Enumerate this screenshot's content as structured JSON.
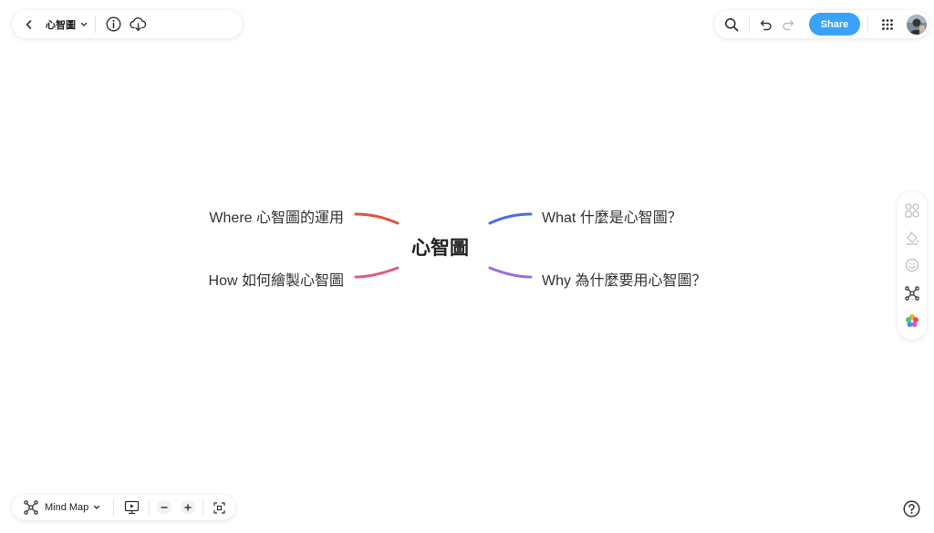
{
  "header": {
    "doc_title": "心智圖",
    "share_label": "Share"
  },
  "toolbar_bottom": {
    "mode_label": "Mind Map"
  },
  "mindmap": {
    "central": "心智圖",
    "branches": [
      {
        "label": "Where 心智圖的運用",
        "color": "#e0533e"
      },
      {
        "label": "How 如何繪製心智圖",
        "color": "#de5a8a"
      },
      {
        "label": "What 什麼是心智圖？",
        "color": "#4a6fe0"
      },
      {
        "label": "Why 為什麼要用心智圖？",
        "color": "#9a6ee0"
      }
    ]
  },
  "icons": {
    "back": "chevron-left-icon",
    "dropdown": "chevron-down-icon",
    "info": "info-icon",
    "download": "cloud-download-icon",
    "search": "search-icon",
    "undo": "undo-icon",
    "redo": "redo-icon",
    "apps": "grid-icon",
    "shapes": "shapes-icon",
    "paint": "paint-bucket-icon",
    "emoji": "emoji-icon",
    "mindmap": "mindmap-icon",
    "theme": "color-palette-icon",
    "present": "presentation-icon",
    "zoom_out": "minus-icon",
    "zoom_in": "plus-icon",
    "fit": "fit-screen-icon",
    "help": "help-icon"
  }
}
